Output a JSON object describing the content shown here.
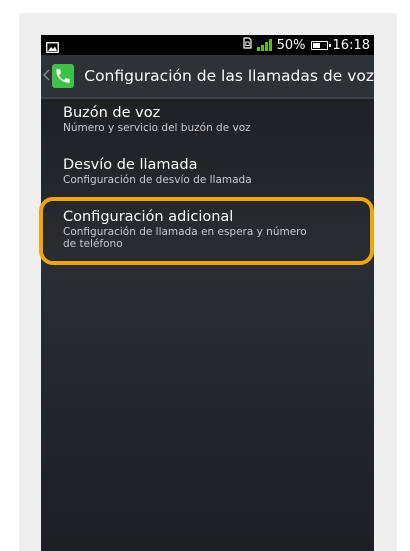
{
  "status_bar": {
    "battery_percent": "50%",
    "time": "16:18",
    "signal_color": "#59c10b",
    "icons": [
      "image-notification-icon",
      "sim-card-icon",
      "signal-icon",
      "battery-icon"
    ]
  },
  "action_bar": {
    "title": "Configuración de las llamadas de voz",
    "app_icon": "phone-icon",
    "icon_color": "#3fc14a"
  },
  "menu": {
    "items": [
      {
        "label": "Buzón de voz",
        "summary": "Número y servicio del buzón de voz"
      },
      {
        "label": "Desvío de llamada",
        "summary": "Configuración de desvío de llamada"
      },
      {
        "label": "Configuración adicional",
        "summary_line1": "Configuración de llamada en espera y número",
        "summary_line2": "de teléfono"
      }
    ]
  },
  "highlight": {
    "target": "Configuración adicional",
    "color": "#f0a50c"
  }
}
